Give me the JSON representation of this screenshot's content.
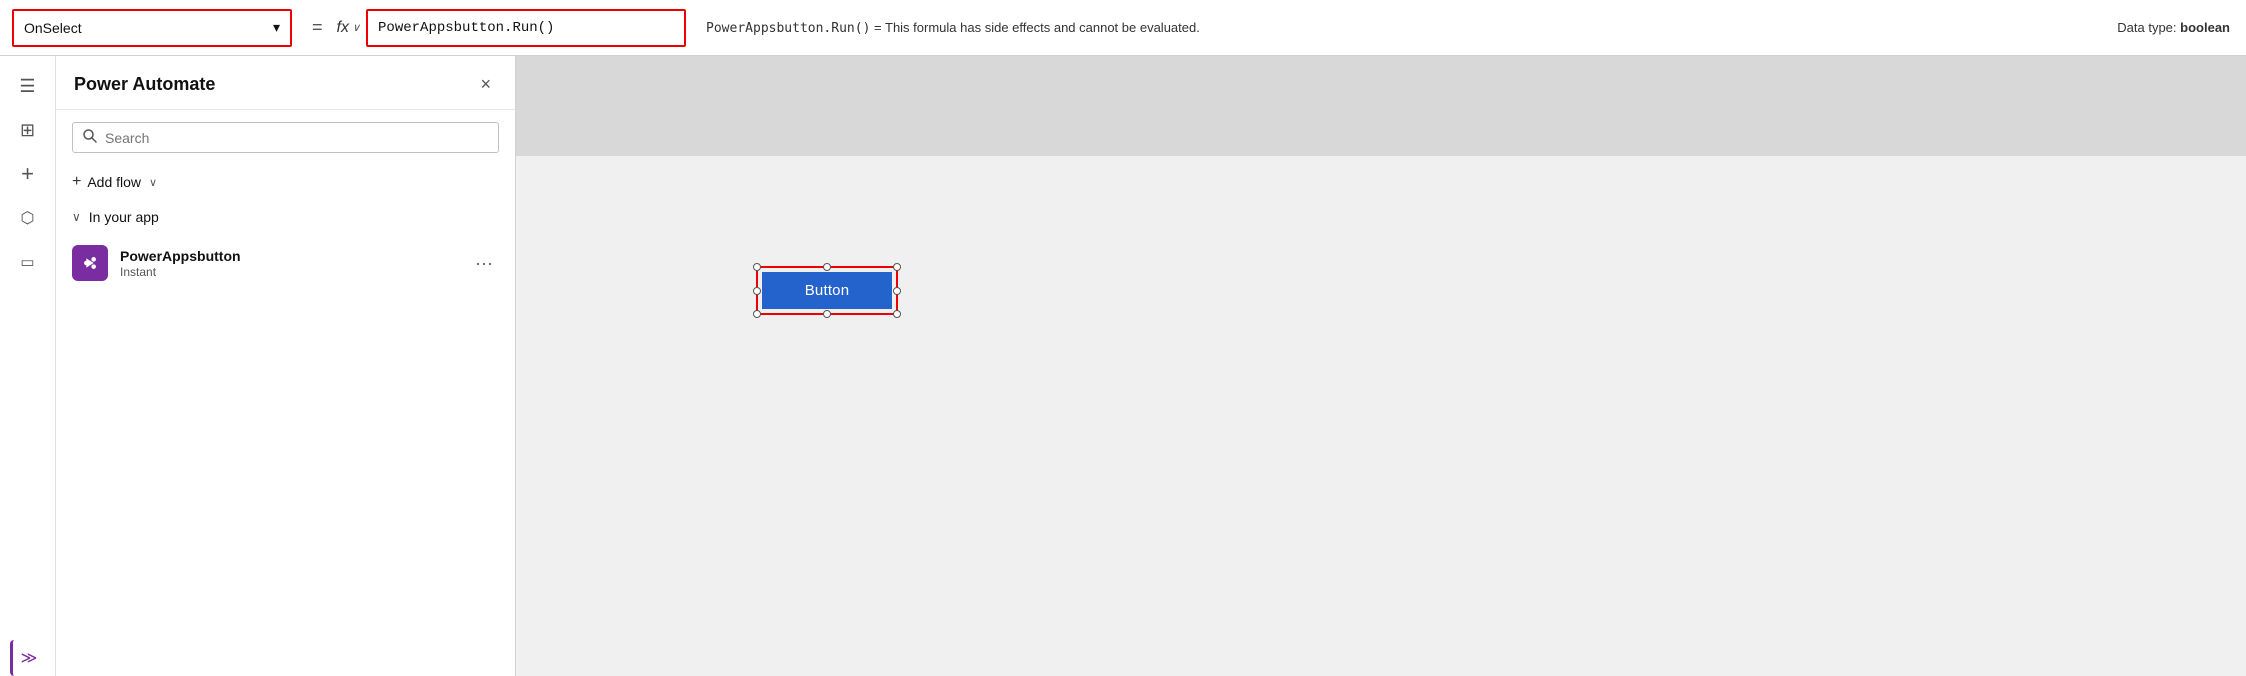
{
  "formulaBar": {
    "property": "OnSelect",
    "equalsSign": "=",
    "fxLabel": "fx",
    "formula": "PowerAppsbutton.Run()",
    "hintFormula": "PowerAppsbutton.Run()",
    "hintEquals": "=",
    "hintMessage": "This formula has side effects and cannot be evaluated.",
    "dataTypeLabel": "Data type:",
    "dataTypeValue": "boolean"
  },
  "sidebar": {
    "hamburgerLabel": "☰",
    "icons": [
      {
        "name": "layers-icon",
        "symbol": "⊞",
        "active": false
      },
      {
        "name": "add-icon",
        "symbol": "+",
        "active": false
      },
      {
        "name": "database-icon",
        "symbol": "⬡",
        "active": false
      },
      {
        "name": "monitor-icon",
        "symbol": "▭",
        "active": false
      },
      {
        "name": "code-icon",
        "symbol": "≫",
        "active": true
      }
    ]
  },
  "powerAutomatePanel": {
    "title": "Power Automate",
    "closeLabel": "×",
    "searchPlaceholder": "Search",
    "addFlowLabel": "Add flow",
    "sectionLabel": "In your app",
    "flow": {
      "name": "PowerAppsbutton",
      "type": "Instant",
      "moreLabel": "···"
    }
  },
  "canvas": {
    "buttonLabel": "Button"
  }
}
